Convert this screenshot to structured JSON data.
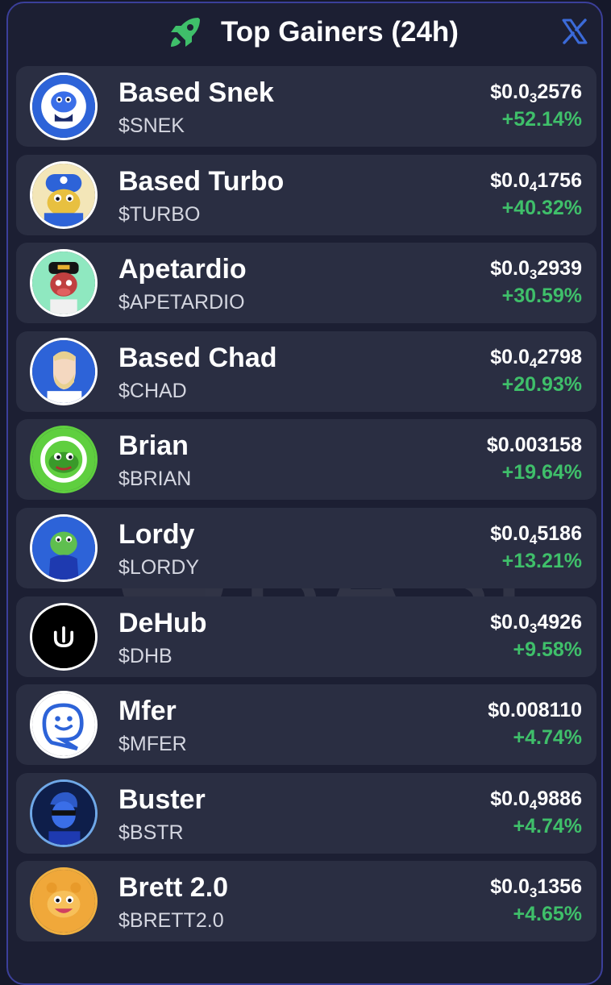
{
  "header": {
    "title": "Top Gainers (24h)",
    "rocket_icon": "rocket-icon",
    "close_icon": "x-icon"
  },
  "watermark": {
    "line1": "Gems of",
    "line2": "BASE"
  },
  "colors": {
    "background": "#15182a",
    "panel": "#1c1f33",
    "card": "#2a2e42",
    "positive": "#3fbf6a",
    "accent": "#3b6ad8"
  },
  "tokens": [
    {
      "name": "Based Snek",
      "ticker": "$SNEK",
      "price_prefix": "$0.0",
      "price_zeros": "3",
      "price_digits": "2576",
      "change": "+52.14%",
      "avatar": "snek-avatar-icon"
    },
    {
      "name": "Based Turbo",
      "ticker": "$TURBO",
      "price_prefix": "$0.0",
      "price_zeros": "4",
      "price_digits": "1756",
      "change": "+40.32%",
      "avatar": "turbo-avatar-icon"
    },
    {
      "name": "Apetardio",
      "ticker": "$APETARDIO",
      "price_prefix": "$0.0",
      "price_zeros": "3",
      "price_digits": "2939",
      "change": "+30.59%",
      "avatar": "apetardio-avatar-icon"
    },
    {
      "name": "Based Chad",
      "ticker": "$CHAD",
      "price_prefix": "$0.0",
      "price_zeros": "4",
      "price_digits": "2798",
      "change": "+20.93%",
      "avatar": "chad-avatar-icon"
    },
    {
      "name": "Brian",
      "ticker": "$BRIAN",
      "price_prefix": "$0.003158",
      "price_zeros": "",
      "price_digits": "",
      "change": "+19.64%",
      "avatar": "brian-avatar-icon"
    },
    {
      "name": "Lordy",
      "ticker": "$LORDY",
      "price_prefix": "$0.0",
      "price_zeros": "4",
      "price_digits": "5186",
      "change": "+13.21%",
      "avatar": "lordy-avatar-icon"
    },
    {
      "name": "DeHub",
      "ticker": "$DHB",
      "price_prefix": "$0.0",
      "price_zeros": "3",
      "price_digits": "4926",
      "change": "+9.58%",
      "avatar": "dehub-avatar-icon"
    },
    {
      "name": "Mfer",
      "ticker": "$MFER",
      "price_prefix": "$0.008110",
      "price_zeros": "",
      "price_digits": "",
      "change": "+4.74%",
      "avatar": "mfer-avatar-icon"
    },
    {
      "name": "Buster",
      "ticker": "$BSTR",
      "price_prefix": "$0.0",
      "price_zeros": "4",
      "price_digits": "9886",
      "change": "+4.74%",
      "avatar": "buster-avatar-icon"
    },
    {
      "name": "Brett 2.0",
      "ticker": "$BRETT2.0",
      "price_prefix": "$0.0",
      "price_zeros": "3",
      "price_digits": "1356",
      "change": "+4.65%",
      "avatar": "brett-avatar-icon"
    }
  ]
}
